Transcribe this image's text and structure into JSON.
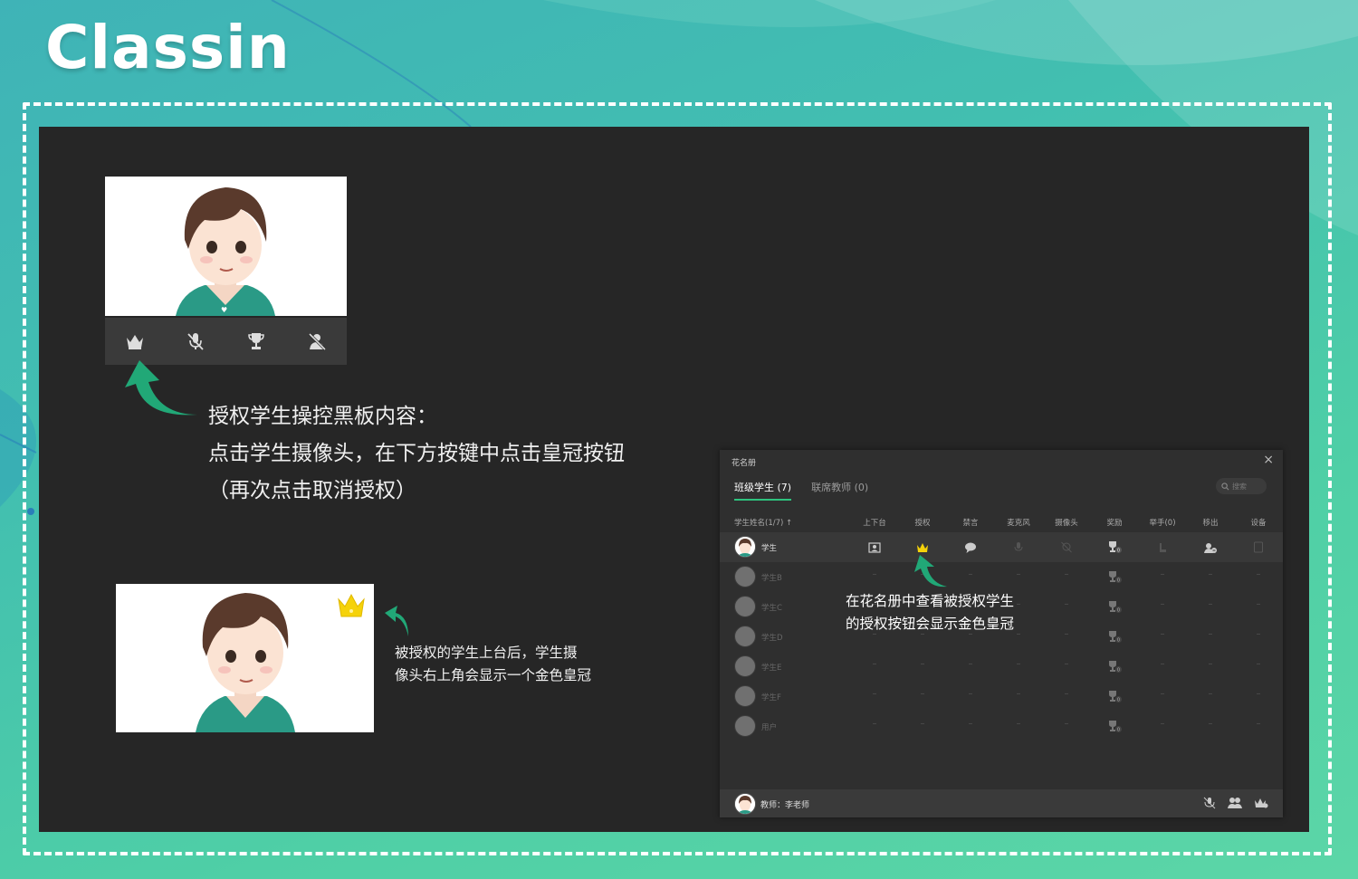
{
  "brand": {
    "logo_text": "Classin"
  },
  "colors": {
    "accent_green": "#2ec27e",
    "crown_gold": "#f5d20a",
    "stage_bg": "#262626"
  },
  "camera_toolbar": {
    "icons": [
      "crown-icon",
      "mic-muted-icon",
      "trophy-icon",
      "camera-off-person-icon"
    ]
  },
  "annotations": {
    "authorize": {
      "line1": "授权学生操控黑板内容：",
      "line2": "点击学生摄像头，在下方按键中点击皇冠按钮",
      "line3": "（再次点击取消授权）"
    },
    "crown_display": {
      "line1": "被授权的学生上台后，学生摄",
      "line2": "像头右上角会显示一个金色皇冠"
    },
    "roster_hint": {
      "line1": "在花名册中查看被授权学生",
      "line2": "的授权按钮会显示金色皇冠"
    }
  },
  "roster": {
    "title": "花名册",
    "close": "×",
    "tabs": [
      {
        "label": "班级学生 (7)",
        "active": true
      },
      {
        "label": "联席教师 (0)",
        "active": false
      }
    ],
    "search_placeholder": "搜索",
    "columns": {
      "name": "学生姓名(1/7) ↑",
      "stage": "上下台",
      "auth": "授权",
      "mute": "禁言",
      "mic": "麦克风",
      "camera": "摄像头",
      "reward": "奖励",
      "hand": "举手(0)",
      "kick": "移出",
      "device": "设备"
    },
    "students": [
      {
        "name": "学生",
        "online": true,
        "reward": "0"
      },
      {
        "name": "学生B",
        "online": false,
        "reward": "0"
      },
      {
        "name": "学生C",
        "online": false,
        "reward": "0"
      },
      {
        "name": "学生D",
        "online": false,
        "reward": "0"
      },
      {
        "name": "学生E",
        "online": false,
        "reward": "0"
      },
      {
        "name": "学生F",
        "online": false,
        "reward": "0"
      },
      {
        "name": "用户",
        "online": false,
        "reward": "0"
      }
    ],
    "placeholder_dash": "–",
    "footer": {
      "teacher": "教师：李老师"
    }
  }
}
